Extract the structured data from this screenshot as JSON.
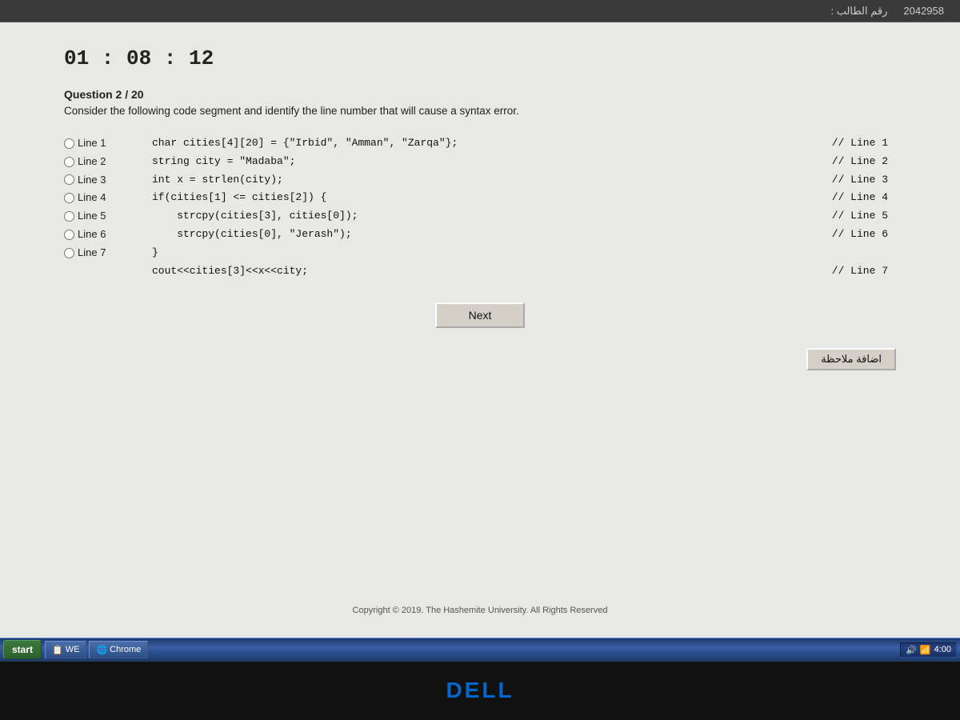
{
  "topbar": {
    "id_label": "رقم الطالب :",
    "id_value": "2042958"
  },
  "timer": {
    "display": "01 : 08 : 12"
  },
  "question": {
    "header": "Question 2 / 20",
    "text": "Consider the following code segment and identify the line number that will cause a syntax error."
  },
  "options": [
    {
      "id": "opt1",
      "label": "Line 1"
    },
    {
      "id": "opt2",
      "label": "Line 2"
    },
    {
      "id": "opt3",
      "label": "Line 3"
    },
    {
      "id": "opt4",
      "label": "Line 4"
    },
    {
      "id": "opt5",
      "label": "Line 5"
    },
    {
      "id": "opt6",
      "label": "Line 6"
    },
    {
      "id": "opt7",
      "label": "Line 7"
    }
  ],
  "code": {
    "line1": "char cities[4][20] = {\"Irbid\", \"Amman\", \"Zarqa\"};",
    "line1_comment": "// Line 1",
    "line2": "string city = \"Madaba\";",
    "line2_comment": "// Line 2",
    "line3": "int x = strlen(city);",
    "line3_comment": "// Line 3",
    "line4": "if(cities[1] <= cities[2]) {",
    "line4_comment": "// Line 4",
    "line5": "    strcpy(cities[3], cities[0]);",
    "line5_comment": "// Line 5",
    "line6": "    strcpy(cities[0], \"Jerash\");",
    "line6_comment": "// Line 6",
    "line7": "}",
    "line8": "cout<<cities[3]<<x<<city;",
    "line8_comment": "// Line 7"
  },
  "buttons": {
    "next": "Next",
    "note": "اضافة ملاحظة"
  },
  "copyright": "Copyright © 2019. The Hashemite University. All Rights Reserved",
  "taskbar": {
    "time": "4:00",
    "items": [
      "WE",
      "Chrome"
    ]
  },
  "dell": "DELL"
}
